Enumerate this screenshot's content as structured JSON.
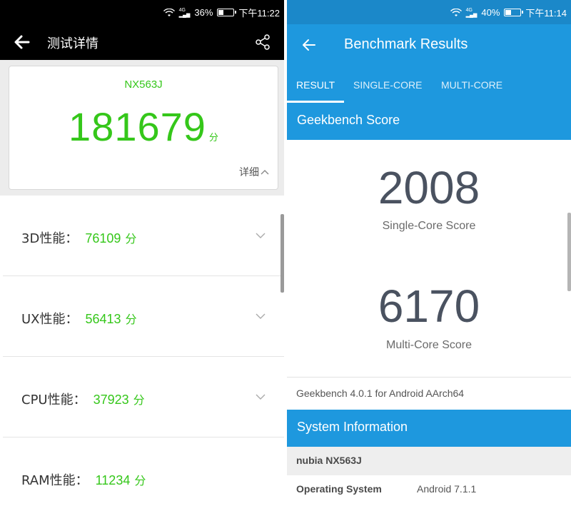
{
  "left": {
    "status": {
      "battery": "36%",
      "time": "下午11:22",
      "network": "4G",
      "battery_level": 0.36
    },
    "title": "测试详情",
    "device": "NX563J",
    "total_score": "181679",
    "unit": "分",
    "detail_label": "详细",
    "categories": [
      {
        "label": "3D性能：",
        "value": "76109",
        "unit": "分"
      },
      {
        "label": "UX性能：",
        "value": "56413",
        "unit": "分"
      },
      {
        "label": "CPU性能：",
        "value": "37923",
        "unit": "分"
      },
      {
        "label": "RAM性能：",
        "value": "11234",
        "unit": "分"
      }
    ],
    "colors": {
      "accent": "#35c71a",
      "bar": "#000000"
    }
  },
  "right": {
    "status": {
      "battery": "40%",
      "time": "下午11:14",
      "network": "4G",
      "battery_level": 0.4
    },
    "title": "Benchmark Results",
    "tabs": [
      {
        "label": "RESULT",
        "active": true
      },
      {
        "label": "SINGLE-CORE",
        "active": false
      },
      {
        "label": "MULTI-CORE",
        "active": false
      }
    ],
    "score_section": "Geekbench Score",
    "single_core_score": "2008",
    "single_core_label": "Single-Core Score",
    "multi_core_score": "6170",
    "multi_core_label": "Multi-Core Score",
    "version": "Geekbench 4.0.1 for Android AArch64",
    "system_section": "System Information",
    "device_name": "nubia NX563J",
    "os_key": "Operating System",
    "os_value": "Android 7.1.1",
    "colors": {
      "accent": "#1e98de",
      "status_bar": "#1b88c9"
    }
  }
}
